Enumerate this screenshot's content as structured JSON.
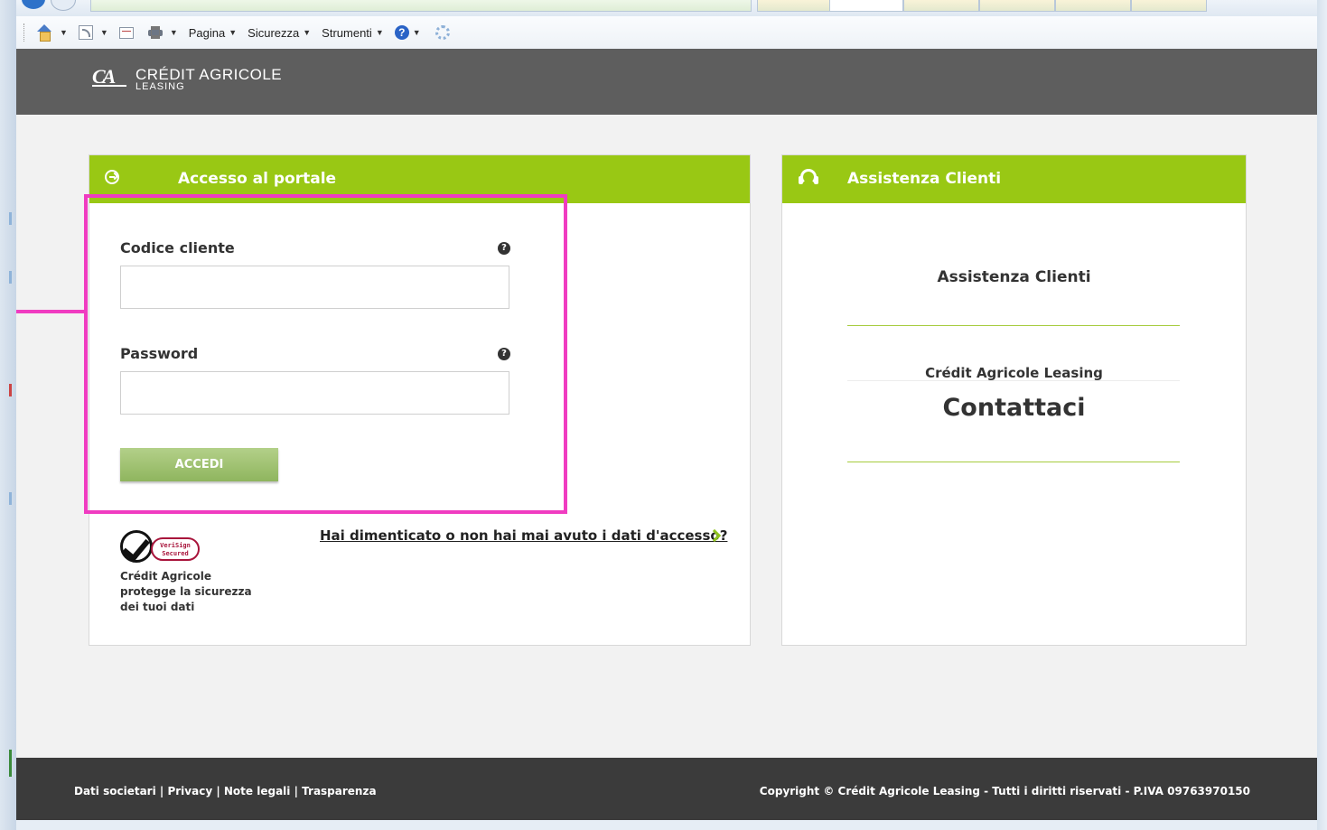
{
  "browser": {
    "commands": {
      "page": "Pagina",
      "security": "Sicurezza",
      "tools": "Strumenti",
      "help_symbol": "?"
    }
  },
  "header": {
    "brand": "CRÉDIT AGRICOLE",
    "sub_brand": "LEASING"
  },
  "login": {
    "title": "Accesso al portale",
    "customer_code_label": "Codice cliente",
    "customer_code_value": "",
    "password_label": "Password",
    "password_value": "",
    "help_symbol": "?",
    "submit_label": "ACCEDI",
    "forgot_link": "Hai dimenticato o non hai mai avuto i dati d'accesso?",
    "verisign_badge_line1": "VeriSign",
    "verisign_badge_line2": "Secured",
    "security_text_line1": "Crédit Agricole",
    "security_text_line2": "protegge la sicurezza",
    "security_text_line3": "dei tuoi dati"
  },
  "support": {
    "title": "Assistenza Clienti",
    "heading": "Assistenza Clienti",
    "company": "Crédit Agricole Leasing",
    "contact": "Contattaci"
  },
  "footer": {
    "links": [
      "Dati societari",
      "Privacy",
      "Note legali",
      "Trasparenza"
    ],
    "separator": " | ",
    "copyright": "Copyright © Crédit Agricole Leasing - Tutti i diritti riservati - P.IVA 09763970150"
  },
  "colors": {
    "accent_green": "#99c814",
    "header_grey": "#5e5e5e",
    "footer_grey": "#3b3b3b",
    "highlight_magenta": "#f03cc1",
    "button_green": "#a3c473"
  }
}
